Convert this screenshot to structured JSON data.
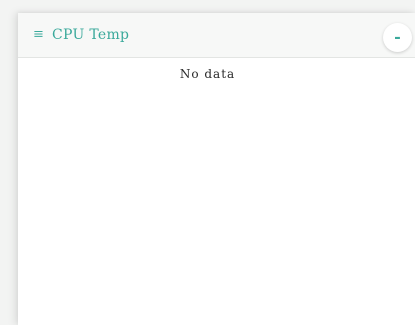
{
  "widget": {
    "icon": "menu-icon",
    "icon_glyph": "≡",
    "title": "CPU Temp",
    "collapse_label": "-",
    "empty_message": "No data",
    "accent_color": "#3aa99b"
  }
}
